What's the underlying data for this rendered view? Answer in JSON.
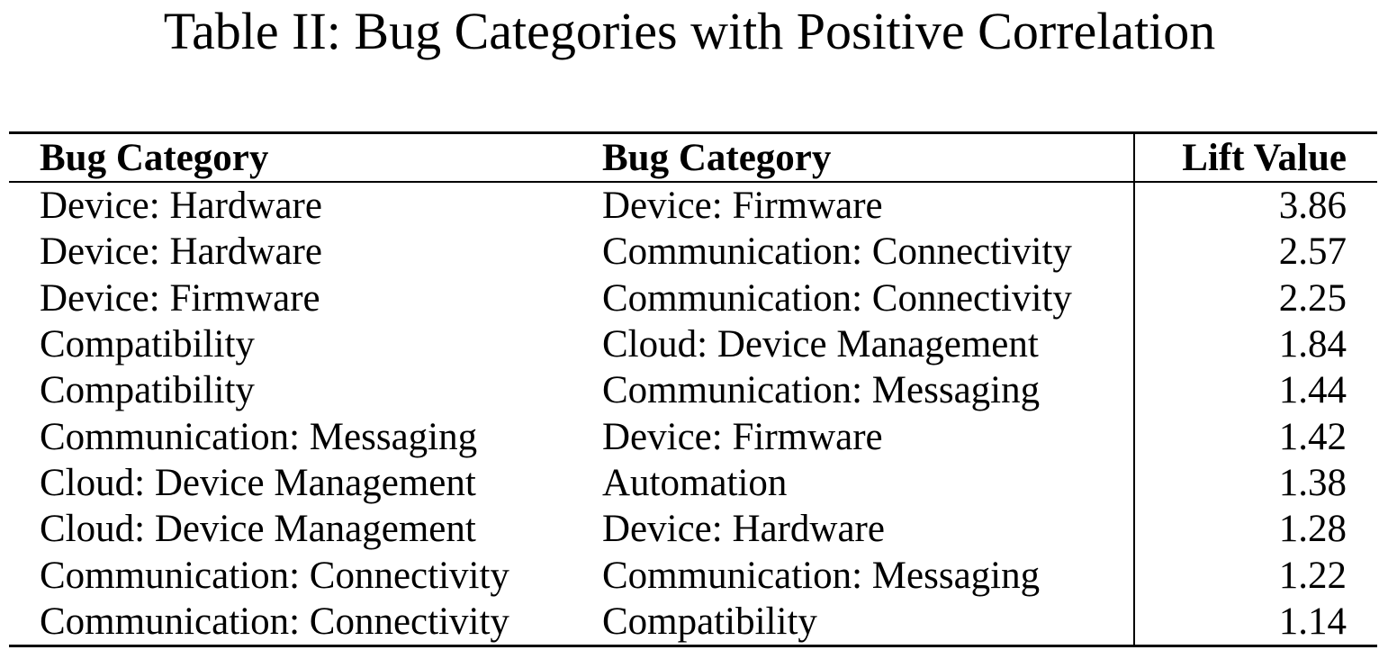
{
  "caption": "Table II: Bug Categories with Positive Correlation",
  "table": {
    "headers": [
      "Bug Category",
      "Bug Category",
      "Lift Value"
    ],
    "rows": [
      [
        "Device: Hardware",
        "Device: Firmware",
        "3.86"
      ],
      [
        "Device: Hardware",
        "Communication: Connectivity",
        "2.57"
      ],
      [
        "Device: Firmware",
        "Communication: Connectivity",
        "2.25"
      ],
      [
        "Compatibility",
        "Cloud: Device Management",
        "1.84"
      ],
      [
        "Compatibility",
        "Communication: Messaging",
        "1.44"
      ],
      [
        "Communication: Messaging",
        "Device: Firmware",
        "1.42"
      ],
      [
        "Cloud: Device Management",
        "Automation",
        "1.38"
      ],
      [
        "Cloud: Device Management",
        "Device: Hardware",
        "1.28"
      ],
      [
        "Communication: Connectivity",
        "Communication: Messaging",
        "1.22"
      ],
      [
        "Communication: Connectivity",
        "Compatibility",
        "1.14"
      ]
    ]
  }
}
